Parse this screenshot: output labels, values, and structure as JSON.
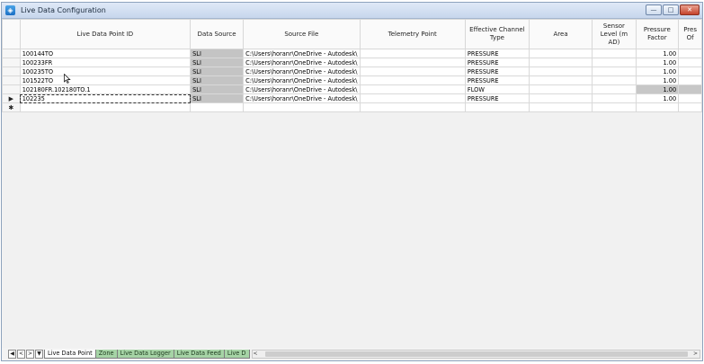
{
  "window": {
    "title": "Live Data Configuration",
    "buttons": {
      "minimize": "—",
      "maximize": "□",
      "close": "✕"
    }
  },
  "grid": {
    "columns": [
      "Live Data Point ID",
      "Data Source",
      "Source File",
      "Telemetry Point",
      "Effective Channel Type",
      "Area",
      "Sensor Level (m AD)",
      "Pressure Factor",
      "Pres Of"
    ],
    "rows": [
      {
        "marker": "",
        "id": "100144TO",
        "source": "SLI",
        "file": "C:\\Users\\horanr\\OneDrive - Autodesk\\",
        "telemetry": "",
        "type": "PRESSURE",
        "area": "",
        "sensor": "",
        "factor": "1.00",
        "offset": ""
      },
      {
        "marker": "",
        "id": "100233FR",
        "source": "SLI",
        "file": "C:\\Users\\horanr\\OneDrive - Autodesk\\",
        "telemetry": "",
        "type": "PRESSURE",
        "area": "",
        "sensor": "",
        "factor": "1.00",
        "offset": ""
      },
      {
        "marker": "",
        "id": "100235TO",
        "source": "SLI",
        "file": "C:\\Users\\horanr\\OneDrive - Autodesk\\",
        "telemetry": "",
        "type": "PRESSURE",
        "area": "",
        "sensor": "",
        "factor": "1.00",
        "offset": ""
      },
      {
        "marker": "",
        "id": "101522TO",
        "source": "SLI",
        "file": "C:\\Users\\horanr\\OneDrive - Autodesk\\",
        "telemetry": "",
        "type": "PRESSURE",
        "area": "",
        "sensor": "",
        "factor": "1.00",
        "offset": ""
      },
      {
        "marker": "",
        "id": "102180FR.102180TO.1",
        "source": "SLI",
        "file": "C:\\Users\\horanr\\OneDrive - Autodesk\\",
        "telemetry": "",
        "type": "FLOW",
        "area": "",
        "sensor": "",
        "factor": "1.00",
        "offset": ""
      },
      {
        "marker": "▶",
        "id": "102235",
        "source": "SLI",
        "file": "C:\\Users\\horanr\\OneDrive - Autodesk\\",
        "telemetry": "",
        "type": "PRESSURE",
        "area": "",
        "sensor": "",
        "factor": "1.00",
        "offset": ""
      }
    ],
    "new_row_marker": "✱"
  },
  "tabs": {
    "nav": [
      "◀",
      "<",
      ">",
      "▼"
    ],
    "items": [
      "Live Data Point",
      "Zone",
      "Live Data Logger",
      "Live Data Feed",
      "Live D"
    ],
    "active_index": 0
  },
  "scrollbar": {
    "left": "<",
    "right": ">"
  },
  "colors": {
    "title_bar": "#c7d6ec",
    "inactive_tab": "#a6d4a6",
    "readonly_cell": "#c4c4c4",
    "close_button": "#c4432b"
  },
  "icons": [
    "window-app-icon",
    "mouse-cursor-icon"
  ]
}
